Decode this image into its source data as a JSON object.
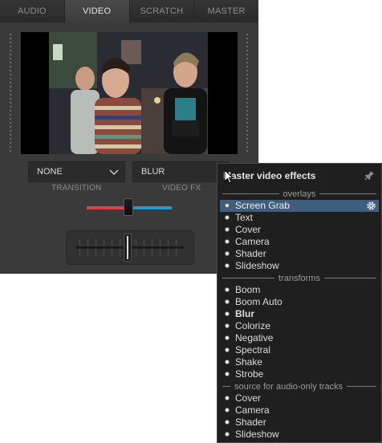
{
  "tabs": [
    {
      "label": "AUDIO",
      "active": false
    },
    {
      "label": "VIDEO",
      "active": true
    },
    {
      "label": "SCRATCH",
      "active": false
    },
    {
      "label": "MASTER",
      "active": false
    }
  ],
  "video": {
    "preview_icon": "video-preview-image",
    "transition_select": {
      "value": "NONE",
      "caption": "TRANSITION"
    },
    "fx_select": {
      "value": "BLUR",
      "caption": "VIDEO FX"
    },
    "crossfader_colors": {
      "left": "#d24646",
      "right": "#2f97c8"
    }
  },
  "menu": {
    "title": "Master video effects",
    "pin_icon": "pin-icon",
    "sections": [
      {
        "label": "overlays",
        "items": [
          "Screen Grab",
          "Text",
          "Cover",
          "Camera",
          "Shader",
          "Slideshow"
        ]
      },
      {
        "label": "transforms",
        "items": [
          "Boom",
          "Boom Auto",
          "Blur",
          "Colorize",
          "Negative",
          "Spectral",
          "Shake",
          "Strobe"
        ]
      },
      {
        "label": "source for audio-only tracks",
        "items": [
          "Cover",
          "Camera",
          "Shader",
          "Slideshow"
        ]
      }
    ],
    "selected_item": "Screen Grab",
    "bold_item": "Blur",
    "settings_icon": "gear-icon",
    "accent": "#3f5d7e"
  }
}
